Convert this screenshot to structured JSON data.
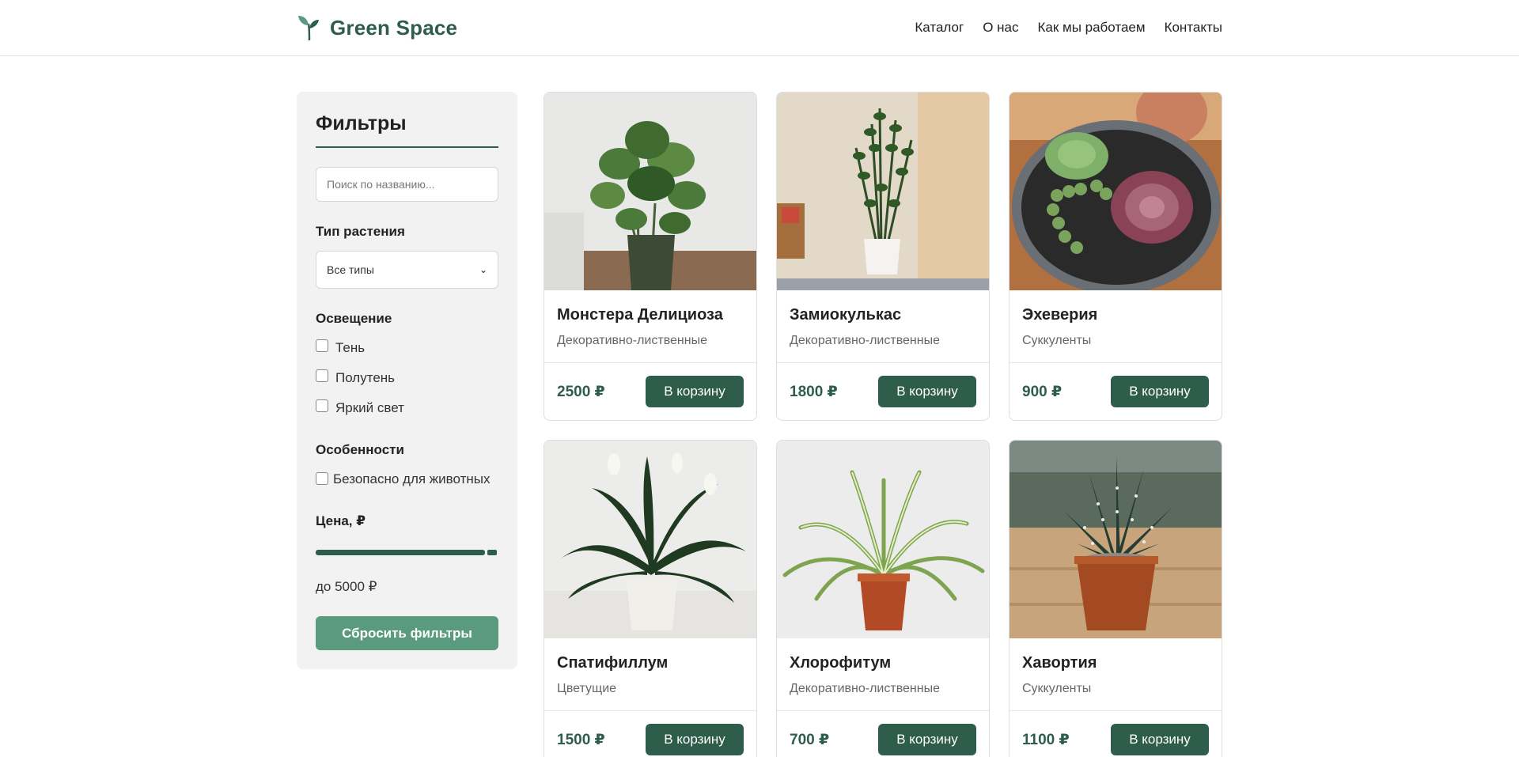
{
  "brand": {
    "name": "Green Space",
    "icon": "leaf-sprout-icon",
    "color": "#2e5e4b"
  },
  "nav": [
    "Каталог",
    "О нас",
    "Как мы работаем",
    "Контакты"
  ],
  "filters": {
    "title": "Фильтры",
    "search_placeholder": "Поиск по названию...",
    "type_label": "Тип растения",
    "type_selected": "Все типы",
    "light_label": "Освещение",
    "light_options": [
      "Тень",
      "Полутень",
      "Яркий свет"
    ],
    "features_label": "Особенности",
    "feature_option": "Безопасно для животных",
    "price_label": "Цена, ₽",
    "price_slider_fraction": 1.0,
    "price_cap": "до 5000 ₽",
    "reset_label": "Сбросить фильтры"
  },
  "buy_label": "В корзину",
  "products": [
    {
      "name": "Монстера Делициоза",
      "category": "Декоративно-лиственные",
      "price": "2500 ₽"
    },
    {
      "name": "Замиокулькас",
      "category": "Декоративно-лиственные",
      "price": "1800 ₽"
    },
    {
      "name": "Эхеверия",
      "category": "Суккуленты",
      "price": "900 ₽"
    },
    {
      "name": "Спатифиллум",
      "category": "Цветущие",
      "price": "1500 ₽"
    },
    {
      "name": "Хлорофитум",
      "category": "Декоративно-лиственные",
      "price": "700 ₽"
    },
    {
      "name": "Хавортия",
      "category": "Суккуленты",
      "price": "1100 ₽"
    }
  ]
}
